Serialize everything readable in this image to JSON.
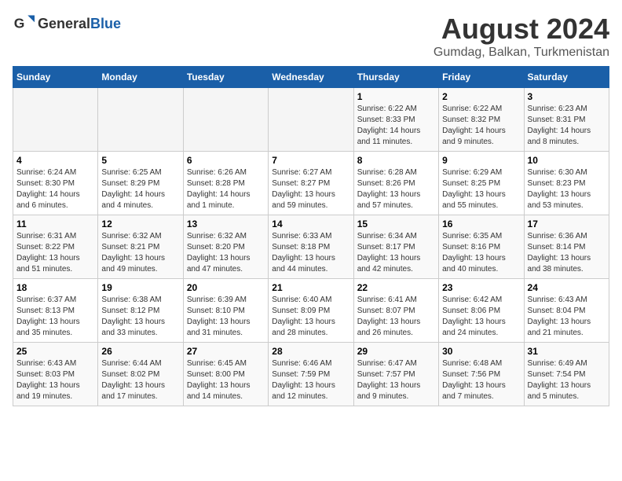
{
  "logo": {
    "general": "General",
    "blue": "Blue"
  },
  "header": {
    "title": "August 2024",
    "subtitle": "Gumdag, Balkan, Turkmenistan"
  },
  "weekdays": [
    "Sunday",
    "Monday",
    "Tuesday",
    "Wednesday",
    "Thursday",
    "Friday",
    "Saturday"
  ],
  "weeks": [
    [
      {
        "day": "",
        "info": ""
      },
      {
        "day": "",
        "info": ""
      },
      {
        "day": "",
        "info": ""
      },
      {
        "day": "",
        "info": ""
      },
      {
        "day": "1",
        "info": "Sunrise: 6:22 AM\nSunset: 8:33 PM\nDaylight: 14 hours\nand 11 minutes."
      },
      {
        "day": "2",
        "info": "Sunrise: 6:22 AM\nSunset: 8:32 PM\nDaylight: 14 hours\nand 9 minutes."
      },
      {
        "day": "3",
        "info": "Sunrise: 6:23 AM\nSunset: 8:31 PM\nDaylight: 14 hours\nand 8 minutes."
      }
    ],
    [
      {
        "day": "4",
        "info": "Sunrise: 6:24 AM\nSunset: 8:30 PM\nDaylight: 14 hours\nand 6 minutes."
      },
      {
        "day": "5",
        "info": "Sunrise: 6:25 AM\nSunset: 8:29 PM\nDaylight: 14 hours\nand 4 minutes."
      },
      {
        "day": "6",
        "info": "Sunrise: 6:26 AM\nSunset: 8:28 PM\nDaylight: 14 hours\nand 1 minute."
      },
      {
        "day": "7",
        "info": "Sunrise: 6:27 AM\nSunset: 8:27 PM\nDaylight: 13 hours\nand 59 minutes."
      },
      {
        "day": "8",
        "info": "Sunrise: 6:28 AM\nSunset: 8:26 PM\nDaylight: 13 hours\nand 57 minutes."
      },
      {
        "day": "9",
        "info": "Sunrise: 6:29 AM\nSunset: 8:25 PM\nDaylight: 13 hours\nand 55 minutes."
      },
      {
        "day": "10",
        "info": "Sunrise: 6:30 AM\nSunset: 8:23 PM\nDaylight: 13 hours\nand 53 minutes."
      }
    ],
    [
      {
        "day": "11",
        "info": "Sunrise: 6:31 AM\nSunset: 8:22 PM\nDaylight: 13 hours\nand 51 minutes."
      },
      {
        "day": "12",
        "info": "Sunrise: 6:32 AM\nSunset: 8:21 PM\nDaylight: 13 hours\nand 49 minutes."
      },
      {
        "day": "13",
        "info": "Sunrise: 6:32 AM\nSunset: 8:20 PM\nDaylight: 13 hours\nand 47 minutes."
      },
      {
        "day": "14",
        "info": "Sunrise: 6:33 AM\nSunset: 8:18 PM\nDaylight: 13 hours\nand 44 minutes."
      },
      {
        "day": "15",
        "info": "Sunrise: 6:34 AM\nSunset: 8:17 PM\nDaylight: 13 hours\nand 42 minutes."
      },
      {
        "day": "16",
        "info": "Sunrise: 6:35 AM\nSunset: 8:16 PM\nDaylight: 13 hours\nand 40 minutes."
      },
      {
        "day": "17",
        "info": "Sunrise: 6:36 AM\nSunset: 8:14 PM\nDaylight: 13 hours\nand 38 minutes."
      }
    ],
    [
      {
        "day": "18",
        "info": "Sunrise: 6:37 AM\nSunset: 8:13 PM\nDaylight: 13 hours\nand 35 minutes."
      },
      {
        "day": "19",
        "info": "Sunrise: 6:38 AM\nSunset: 8:12 PM\nDaylight: 13 hours\nand 33 minutes."
      },
      {
        "day": "20",
        "info": "Sunrise: 6:39 AM\nSunset: 8:10 PM\nDaylight: 13 hours\nand 31 minutes."
      },
      {
        "day": "21",
        "info": "Sunrise: 6:40 AM\nSunset: 8:09 PM\nDaylight: 13 hours\nand 28 minutes."
      },
      {
        "day": "22",
        "info": "Sunrise: 6:41 AM\nSunset: 8:07 PM\nDaylight: 13 hours\nand 26 minutes."
      },
      {
        "day": "23",
        "info": "Sunrise: 6:42 AM\nSunset: 8:06 PM\nDaylight: 13 hours\nand 24 minutes."
      },
      {
        "day": "24",
        "info": "Sunrise: 6:43 AM\nSunset: 8:04 PM\nDaylight: 13 hours\nand 21 minutes."
      }
    ],
    [
      {
        "day": "25",
        "info": "Sunrise: 6:43 AM\nSunset: 8:03 PM\nDaylight: 13 hours\nand 19 minutes."
      },
      {
        "day": "26",
        "info": "Sunrise: 6:44 AM\nSunset: 8:02 PM\nDaylight: 13 hours\nand 17 minutes."
      },
      {
        "day": "27",
        "info": "Sunrise: 6:45 AM\nSunset: 8:00 PM\nDaylight: 13 hours\nand 14 minutes."
      },
      {
        "day": "28",
        "info": "Sunrise: 6:46 AM\nSunset: 7:59 PM\nDaylight: 13 hours\nand 12 minutes."
      },
      {
        "day": "29",
        "info": "Sunrise: 6:47 AM\nSunset: 7:57 PM\nDaylight: 13 hours\nand 9 minutes."
      },
      {
        "day": "30",
        "info": "Sunrise: 6:48 AM\nSunset: 7:56 PM\nDaylight: 13 hours\nand 7 minutes."
      },
      {
        "day": "31",
        "info": "Sunrise: 6:49 AM\nSunset: 7:54 PM\nDaylight: 13 hours\nand 5 minutes."
      }
    ]
  ]
}
